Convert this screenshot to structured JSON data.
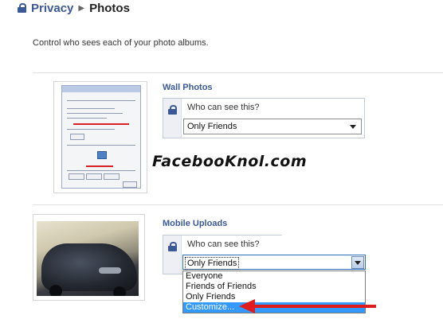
{
  "header": {
    "breadcrumb_parent": "Privacy",
    "breadcrumb_sep": "▶",
    "breadcrumb_current": "Photos"
  },
  "description": "Control who sees each of your photo albums.",
  "albums": [
    {
      "title": "Wall Photos",
      "question": "Who can see this?",
      "selected": "Only Friends"
    },
    {
      "title": "Mobile Uploads",
      "question": "Who can see this?",
      "selected": "Only Friends",
      "options": [
        "Everyone",
        "Friends of Friends",
        "Only Friends",
        "Customize..."
      ],
      "highlighted": "Customize..."
    }
  ],
  "watermark": "FacebooKnol.com",
  "colors": {
    "link": "#3b5998",
    "highlight": "#3399ff",
    "arrow": "#e01b1b"
  }
}
